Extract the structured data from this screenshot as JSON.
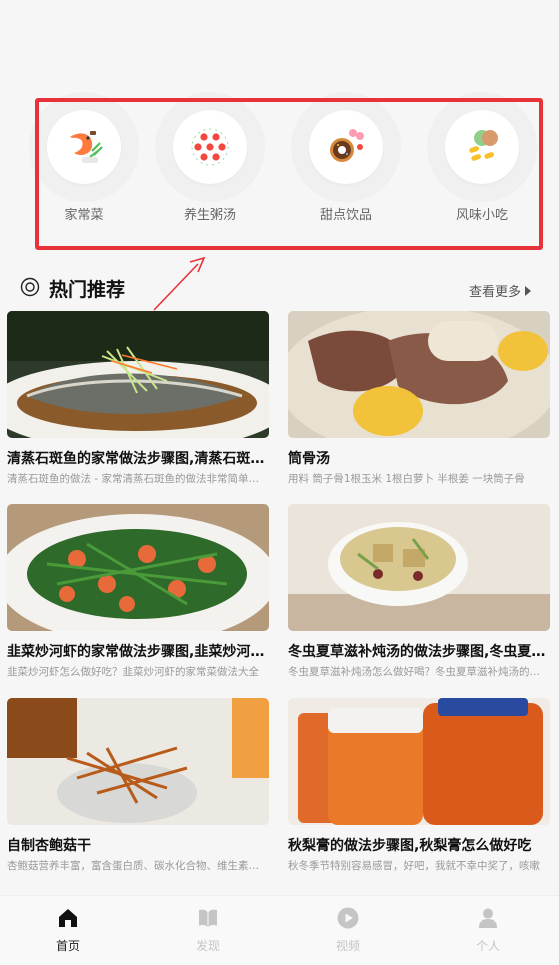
{
  "categories": [
    {
      "label": "家常菜",
      "icon": "shrimp-dish-icon"
    },
    {
      "label": "养生粥汤",
      "icon": "berries-bowl-icon"
    },
    {
      "label": "甜点饮品",
      "icon": "donut-candy-icon"
    },
    {
      "label": "风味小吃",
      "icon": "snack-icon"
    }
  ],
  "section": {
    "title": "热门推荐",
    "more": "查看更多"
  },
  "recipes": [
    {
      "title": "清蒸石斑鱼的家常做法步骤图,清蒸石斑鱼怎么做好吃",
      "desc": "清蒸石斑鱼的做法 - 家常清蒸石斑鱼的做法非常简单好吃"
    },
    {
      "title": "筒骨汤",
      "desc": "用料  筒子骨1根玉米   1根白萝卜   半根姜  一块筒子骨"
    },
    {
      "title": "韭菜炒河虾的家常做法步骤图,韭菜炒河虾怎么做",
      "desc": "韭菜炒河虾怎么做好吃？韭菜炒河虾的家常菜做法大全"
    },
    {
      "title": "冬虫夏草滋补炖汤的做法步骤图,冬虫夏草怎么做",
      "desc": "冬虫夏草滋补炖汤怎么做好喝？冬虫夏草滋补炖汤的做法"
    },
    {
      "title": "自制杏鲍菇干",
      "desc": "杏鲍菇营养丰富，富含蛋白质、碳水化合物、维生素及钙"
    },
    {
      "title": "秋梨膏的做法步骤图,秋梨膏怎么做好吃",
      "desc": "秋冬季节特别容易感冒，好吧，我就不幸中奖了，咳嗽"
    }
  ],
  "nav": [
    {
      "label": "首页",
      "icon": "home-icon",
      "active": true
    },
    {
      "label": "发现",
      "icon": "book-icon",
      "active": false
    },
    {
      "label": "视频",
      "icon": "play-icon",
      "active": false
    },
    {
      "label": "个人",
      "icon": "user-icon",
      "active": false
    }
  ],
  "colors": {
    "highlight": "#e8323a",
    "background": "#f6f6f6",
    "active_nav": "#222222",
    "inactive_nav": "#c5c5c5"
  }
}
